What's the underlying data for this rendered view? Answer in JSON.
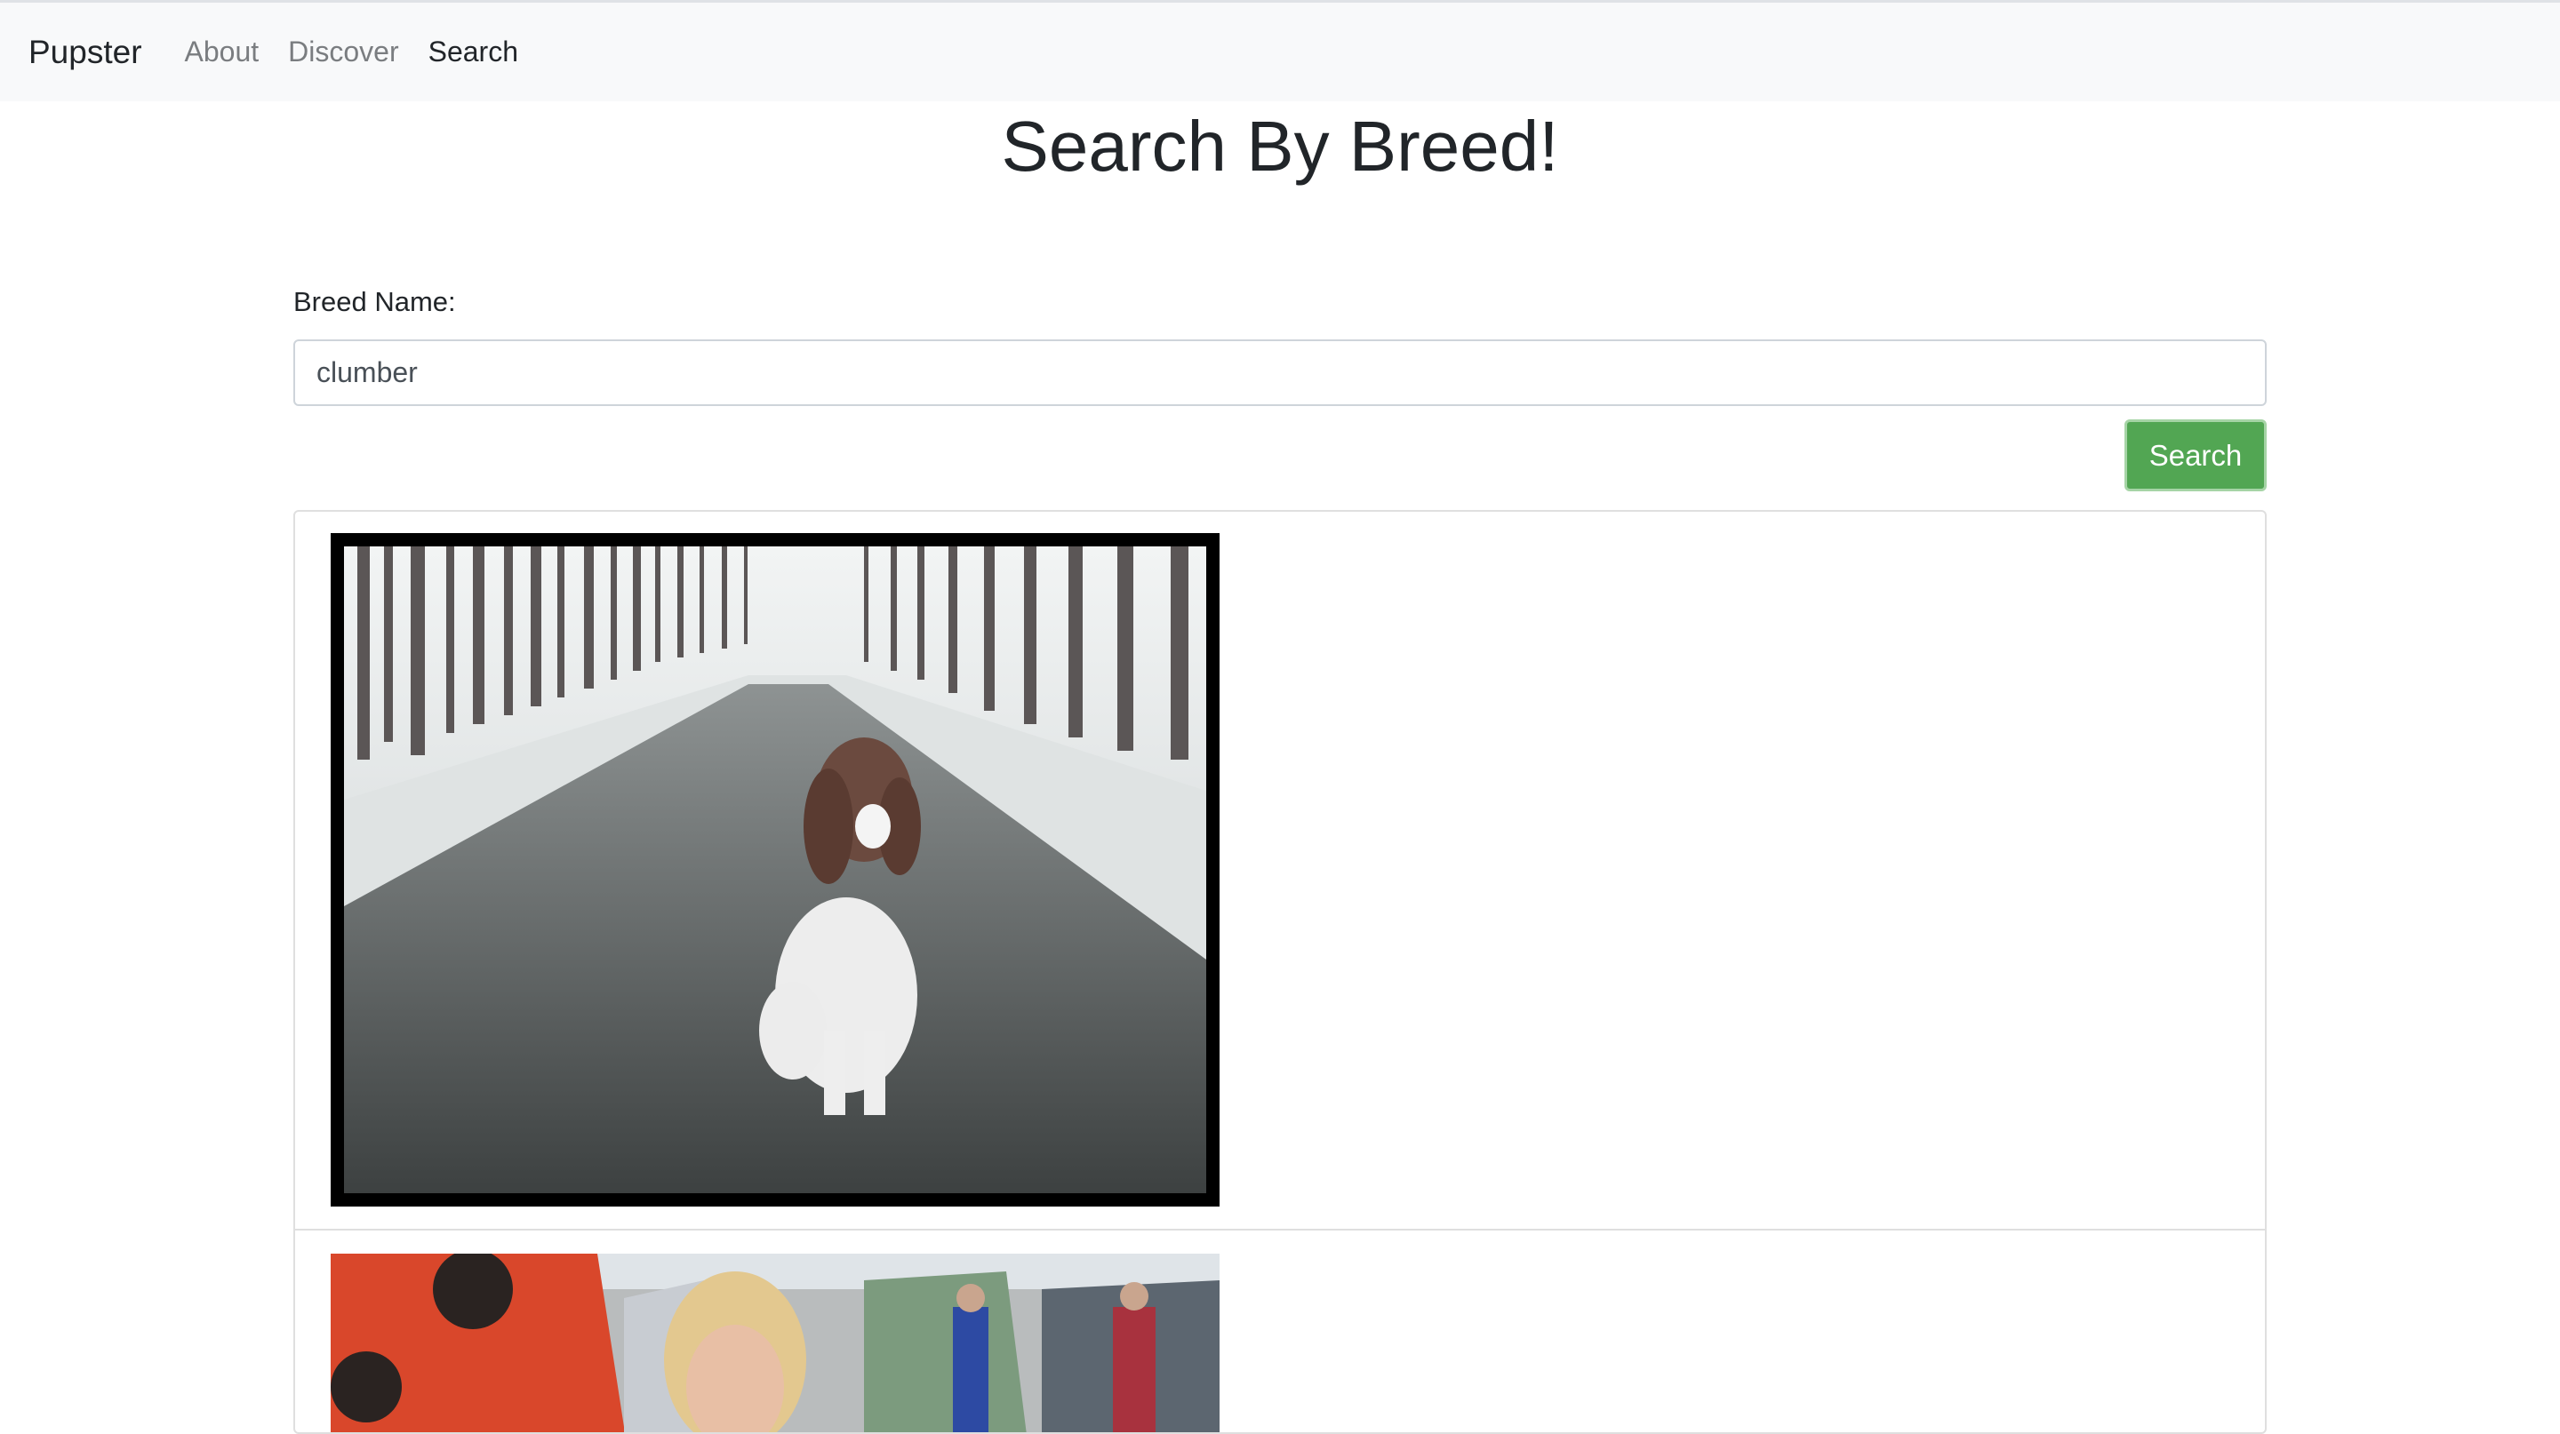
{
  "navbar": {
    "brand": "Pupster",
    "links": [
      {
        "label": "About",
        "active": false
      },
      {
        "label": "Discover",
        "active": false
      },
      {
        "label": "Search",
        "active": true
      }
    ]
  },
  "page": {
    "title": "Search By Breed!"
  },
  "form": {
    "label": "Breed Name:",
    "input_value": "clumber",
    "button_label": "Search",
    "button_color": "#52a653"
  },
  "results": {
    "images": [
      {
        "subject": "spaniel-sitting-on-forest-path"
      },
      {
        "subject": "woman-at-dog-show-campsite"
      }
    ]
  }
}
